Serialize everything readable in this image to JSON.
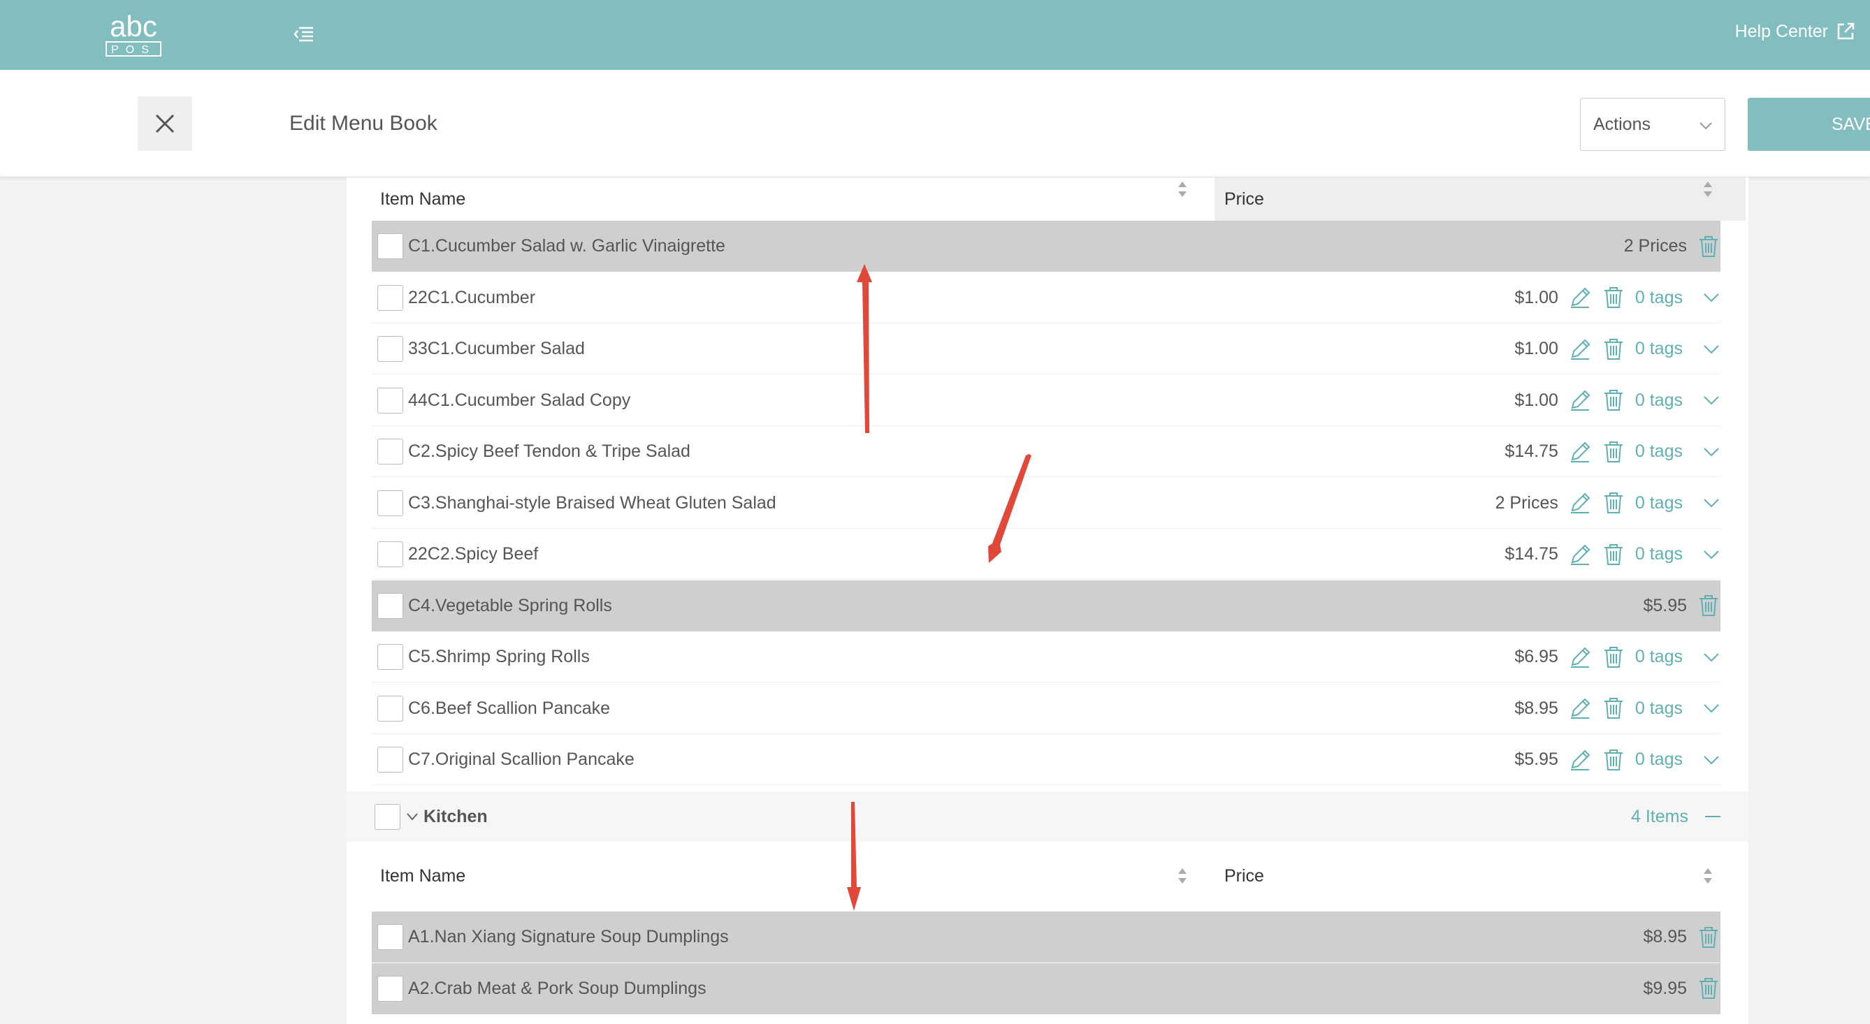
{
  "topbar": {
    "logo_text": "abc",
    "logo_sub": "POS",
    "help_label": "Help Center"
  },
  "header": {
    "title": "Edit Menu Book",
    "actions_label": "Actions",
    "save_label": "SAVE"
  },
  "columns": {
    "item_name": "Item Name",
    "price": "Price"
  },
  "rows": [
    {
      "name": "C1.Cucumber Salad w. Garlic Vinaigrette",
      "price": "2 Prices",
      "group": true
    },
    {
      "name": "22C1.Cucumber",
      "price": "$1.00",
      "tags": "0 tags"
    },
    {
      "name": "33C1.Cucumber Salad",
      "price": "$1.00",
      "tags": "0 tags"
    },
    {
      "name": "44C1.Cucumber Salad Copy",
      "price": "$1.00",
      "tags": "0 tags"
    },
    {
      "name": "C2.Spicy Beef Tendon & Tripe Salad",
      "price": "$14.75",
      "tags": "0 tags"
    },
    {
      "name": "C3.Shanghai-style Braised Wheat Gluten Salad",
      "price": "2 Prices",
      "tags": "0 tags"
    },
    {
      "name": "22C2.Spicy Beef",
      "price": "$14.75",
      "tags": "0 tags"
    },
    {
      "name": "C4.Vegetable Spring Rolls",
      "price": "$5.95",
      "group": true
    },
    {
      "name": "C5.Shrimp Spring Rolls",
      "price": "$6.95",
      "tags": "0 tags"
    },
    {
      "name": "C6.Beef Scallion Pancake",
      "price": "$8.95",
      "tags": "0 tags"
    },
    {
      "name": "C7.Original Scallion Pancake",
      "price": "$5.95",
      "tags": "0 tags"
    }
  ],
  "section": {
    "name": "Kitchen",
    "count": "4 Items"
  },
  "kitchen_rows": [
    {
      "name": "A1.Nan Xiang Signature Soup Dumplings",
      "price": "$8.95",
      "group": true
    },
    {
      "name": "A2.Crab Meat & Pork Soup Dumplings",
      "price": "$9.95",
      "group": true
    }
  ],
  "colors": {
    "accent": "#82bebf",
    "tag_color": "#5fb0b3",
    "group_row": "#cfcfcf",
    "annotation_arrow": "#e0493a"
  }
}
